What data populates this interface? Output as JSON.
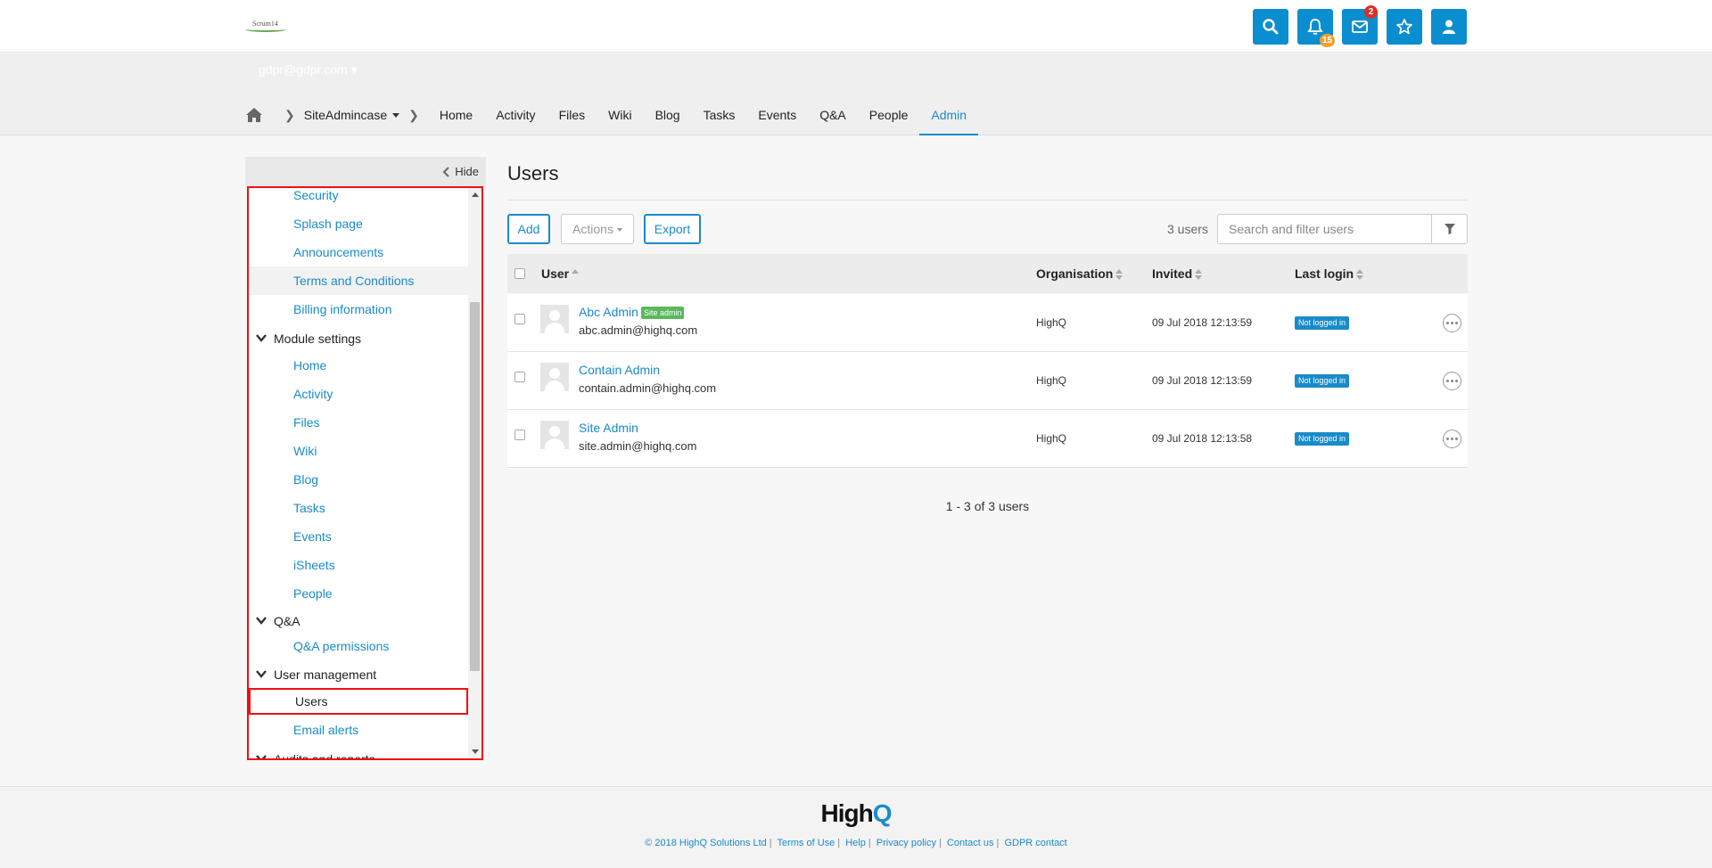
{
  "topbar": {
    "logo_text": "Scrum14",
    "buttons": [
      {
        "icon": "search-icon"
      },
      {
        "icon": "bell-icon",
        "badge": "15"
      },
      {
        "icon": "envelope-icon",
        "badge": "2"
      },
      {
        "icon": "star-icon"
      },
      {
        "icon": "user-icon"
      }
    ]
  },
  "account": {
    "email": "gdpr@gdpr.com"
  },
  "nav": {
    "site": "SiteAdmincase",
    "tabs": [
      "Home",
      "Activity",
      "Files",
      "Wiki",
      "Blog",
      "Tasks",
      "Events",
      "Q&A",
      "People",
      "Admin"
    ],
    "active_tab": "Admin"
  },
  "sidebar": {
    "hide_label": "Hide",
    "items_top": [
      "Security",
      "Splash page",
      "Announcements",
      "Terms and Conditions",
      "Billing information"
    ],
    "groups": [
      {
        "label": "Module settings",
        "items": [
          "Home",
          "Activity",
          "Files",
          "Wiki",
          "Blog",
          "Tasks",
          "Events",
          "iSheets",
          "People"
        ]
      },
      {
        "label": "Q&A",
        "items": [
          "Q&A permissions"
        ]
      },
      {
        "label": "User management",
        "items": [
          "Users",
          "Email alerts"
        ]
      },
      {
        "label": "Audits and reports",
        "items": []
      }
    ],
    "selected": "Users"
  },
  "main": {
    "title": "Users",
    "add_label": "Add",
    "actions_label": "Actions",
    "export_label": "Export",
    "count": "3 users",
    "search_placeholder": "Search and filter users",
    "columns": [
      "User",
      "Organisation",
      "Invited",
      "Last login"
    ],
    "rows": [
      {
        "name": "Abc Admin",
        "badge": "Site admin",
        "email": "abc.admin@highq.com",
        "org": "HighQ",
        "invited": "09 Jul 2018 12:13:59",
        "login": "Not logged in"
      },
      {
        "name": "Contain Admin",
        "badge": "",
        "email": "contain.admin@highq.com",
        "org": "HighQ",
        "invited": "09 Jul 2018 12:13:59",
        "login": "Not logged in"
      },
      {
        "name": "Site Admin",
        "badge": "",
        "email": "site.admin@highq.com",
        "org": "HighQ",
        "invited": "09 Jul 2018 12:13:58",
        "login": "Not logged in"
      }
    ],
    "pager": "1 - 3 of 3 users"
  },
  "footer": {
    "logo_main": "High",
    "logo_q": "Q",
    "copyright": "© 2018 HighQ Solutions Ltd",
    "links": [
      "Terms of Use",
      "Help",
      "Privacy policy",
      "Contact us",
      "GDPR contact"
    ]
  },
  "colors": {
    "accent": "#1a8bc9",
    "topbar_button": "#0b8ed0",
    "site_admin_badge": "#5cb85c",
    "highlight_border": "#ee1111"
  }
}
